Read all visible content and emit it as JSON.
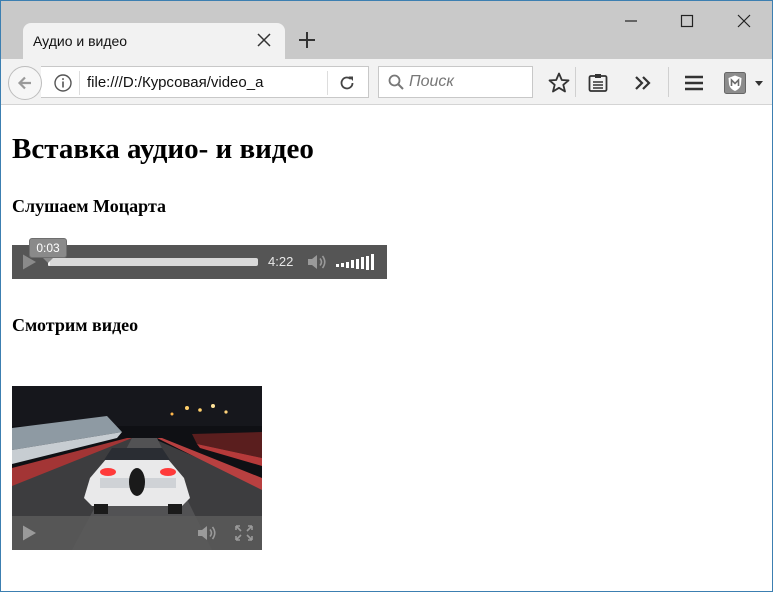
{
  "browser": {
    "tab_title": "Аудио и видео",
    "url": "file:///D:/Курсовая/video_a",
    "search_placeholder": "Поиск"
  },
  "page": {
    "heading": "Вставка аудио- и видео",
    "audio_section_title": "Слушаем Моцарта",
    "video_section_title": "Смотрим видео"
  },
  "audio_player": {
    "current_time": "0:03",
    "duration": "4:22",
    "progress_fraction": 0.011,
    "volume_level": 1.0
  },
  "colors": {
    "window_border": "#3c7fb1",
    "tabstrip_bg": "#c9c9c9",
    "toolbar_bg": "#f2f2f2",
    "player_bg": "#555555"
  }
}
